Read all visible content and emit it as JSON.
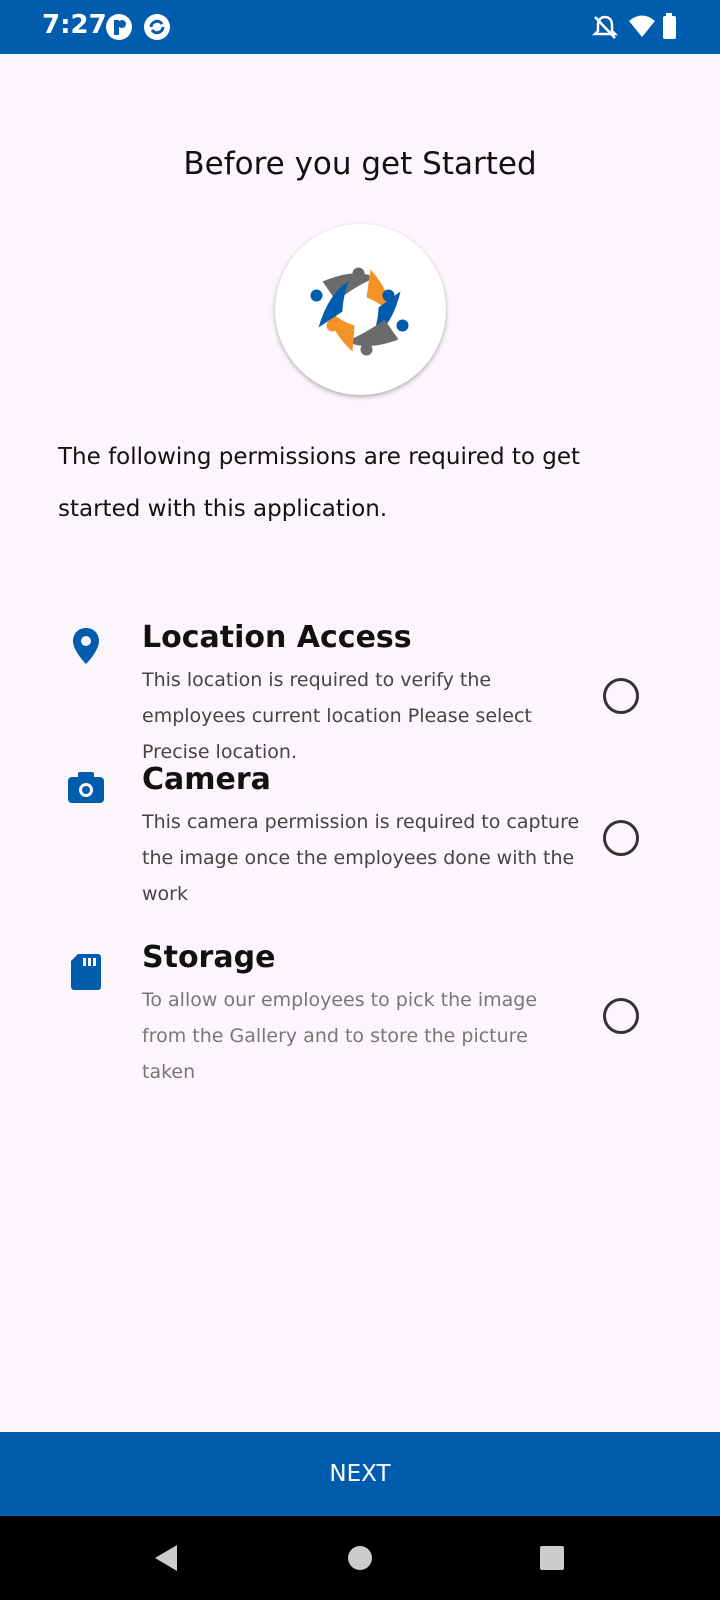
{
  "status_bar": {
    "time": "7:27",
    "left_icons": [
      "app-icon-1",
      "sync-icon"
    ],
    "right_icons": [
      "bell-off-icon",
      "wifi-icon",
      "battery-icon"
    ],
    "color": "#005cad"
  },
  "page": {
    "title": "Before you get Started",
    "intro": "The following permissions are required to get started with this application."
  },
  "permissions": [
    {
      "icon": "location-pin-icon",
      "title": "Location Access",
      "description": "This location is required to verify the employees current location Please select Precise location.",
      "checked": false
    },
    {
      "icon": "camera-icon",
      "title": "Camera",
      "description": "This camera permission is required to capture the image once the employees done with the work",
      "checked": false
    },
    {
      "icon": "sd-card-icon",
      "title": "Storage",
      "description": "To allow our employees to pick the image from the Gallery and to store the picture taken",
      "checked": false
    }
  ],
  "next_button": {
    "label": "NEXT",
    "color": "#005cad"
  },
  "nav_bar": {
    "items": [
      "back-icon",
      "home-icon",
      "recents-icon"
    ]
  },
  "colors": {
    "accent": "#005cad",
    "logo_orange": "#f39325",
    "logo_gray": "#6b6b6b"
  }
}
